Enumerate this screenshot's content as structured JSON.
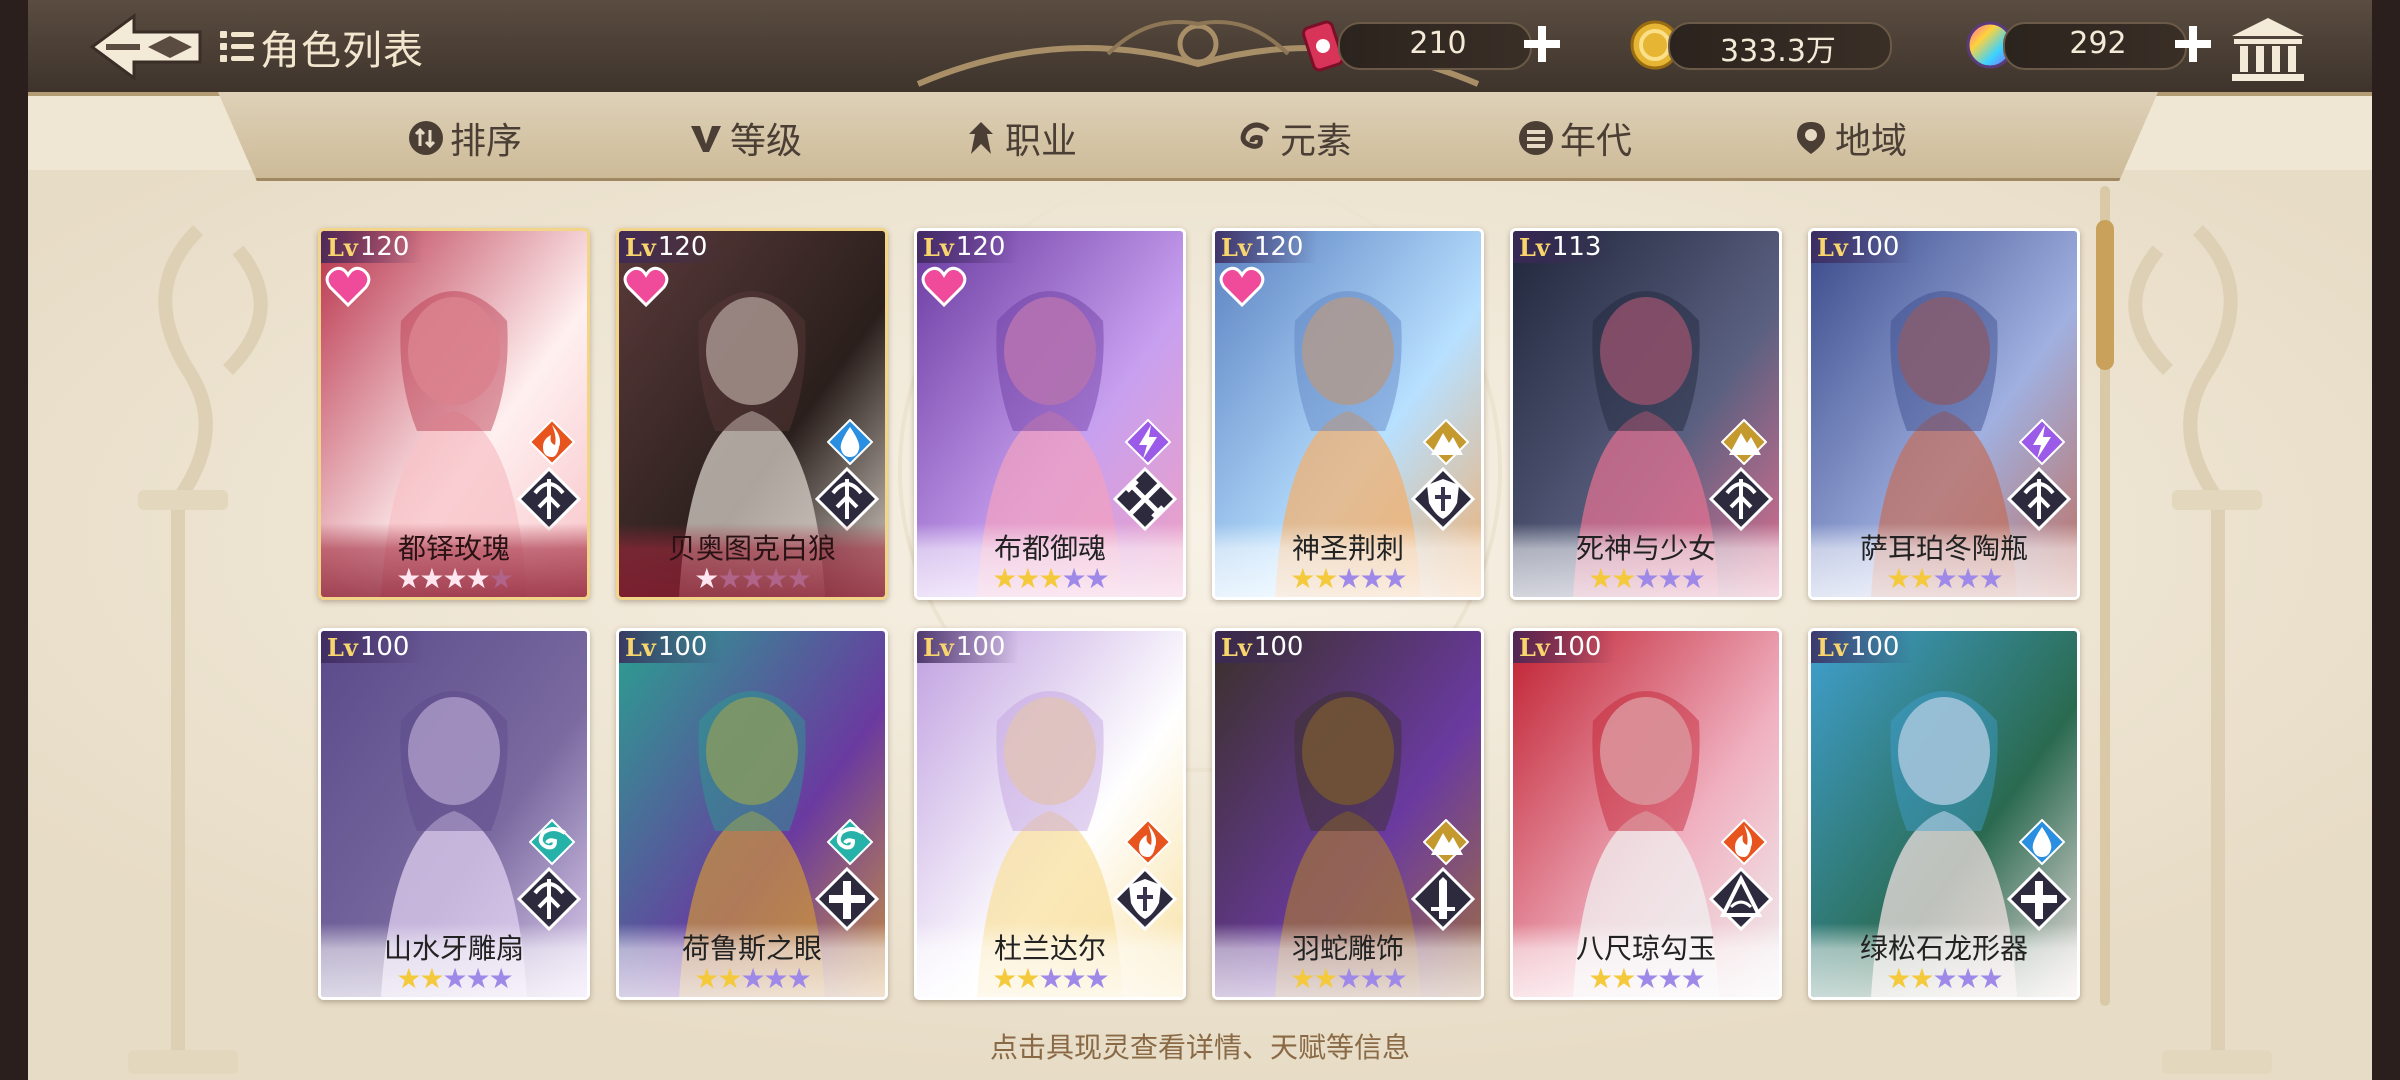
{
  "header": {
    "title": "角色列表",
    "resources": [
      {
        "icon": "ticket-can-icon",
        "value": "210"
      },
      {
        "icon": "gold-coin-icon",
        "value": "333.3万"
      },
      {
        "icon": "rainbow-gem-icon",
        "value": "292"
      }
    ]
  },
  "filters": [
    {
      "label": "排序",
      "icon": "sort-icon"
    },
    {
      "label": "等级",
      "icon": "level-v-icon"
    },
    {
      "label": "职业",
      "icon": "class-icon"
    },
    {
      "label": "元素",
      "icon": "element-swirl-icon"
    },
    {
      "label": "年代",
      "icon": "era-icon"
    },
    {
      "label": "地域",
      "icon": "location-pin-icon"
    }
  ],
  "cards": [
    {
      "name": "都铎玫瑰",
      "lv_prefix": "Lv",
      "lv": "120",
      "favorite": true,
      "element": "fire",
      "role": "archer",
      "stars": 4,
      "max_stars": 5,
      "style": "red"
    },
    {
      "name": "贝奥图克白狼",
      "lv_prefix": "Lv",
      "lv": "120",
      "favorite": true,
      "element": "water",
      "role": "archer",
      "stars": 1,
      "max_stars": 5,
      "style": "red"
    },
    {
      "name": "布都御魂",
      "lv_prefix": "Lv",
      "lv": "120",
      "favorite": true,
      "element": "thunder",
      "role": "warrior",
      "stars": 3,
      "max_stars": 5,
      "style": "purple"
    },
    {
      "name": "神圣荆刺",
      "lv_prefix": "Lv",
      "lv": "120",
      "favorite": true,
      "element": "earth",
      "role": "guardian",
      "stars": 2,
      "max_stars": 5,
      "style": "purple"
    },
    {
      "name": "死神与少女",
      "lv_prefix": "Lv",
      "lv": "113",
      "favorite": false,
      "element": "earth",
      "role": "archer",
      "stars": 2,
      "max_stars": 5,
      "style": "purple"
    },
    {
      "name": "萨耳珀冬陶瓶",
      "lv_prefix": "Lv",
      "lv": "100",
      "favorite": false,
      "element": "thunder",
      "role": "archer",
      "stars": 2,
      "max_stars": 5,
      "style": "purple"
    },
    {
      "name": "山水牙雕扇",
      "lv_prefix": "Lv",
      "lv": "100",
      "favorite": false,
      "element": "wind",
      "role": "archer",
      "stars": 2,
      "max_stars": 5,
      "style": "purple"
    },
    {
      "name": "荷鲁斯之眼",
      "lv_prefix": "Lv",
      "lv": "100",
      "favorite": false,
      "element": "wind",
      "role": "healer",
      "stars": 2,
      "max_stars": 5,
      "style": "purple"
    },
    {
      "name": "杜兰达尔",
      "lv_prefix": "Lv",
      "lv": "100",
      "favorite": false,
      "element": "fire",
      "role": "guardian",
      "stars": 2,
      "max_stars": 5,
      "style": "purple"
    },
    {
      "name": "羽蛇雕饰",
      "lv_prefix": "Lv",
      "lv": "100",
      "favorite": false,
      "element": "earth",
      "role": "sword",
      "stars": 2,
      "max_stars": 5,
      "style": "purple"
    },
    {
      "name": "八尺琼勾玉",
      "lv_prefix": "Lv",
      "lv": "100",
      "favorite": false,
      "element": "fire",
      "role": "mage",
      "stars": 2,
      "max_stars": 5,
      "style": "purple"
    },
    {
      "name": "绿松石龙形器",
      "lv_prefix": "Lv",
      "lv": "100",
      "favorite": false,
      "element": "water",
      "role": "healer",
      "stars": 2,
      "max_stars": 5,
      "style": "purple"
    }
  ],
  "colors": {
    "fire": "#e8541e",
    "water": "#2a8fe0",
    "thunder": "#9b5be8",
    "earth": "#c49a2e",
    "wind": "#26b2a8"
  },
  "hint": "点击具现灵查看详情、天赋等信息"
}
